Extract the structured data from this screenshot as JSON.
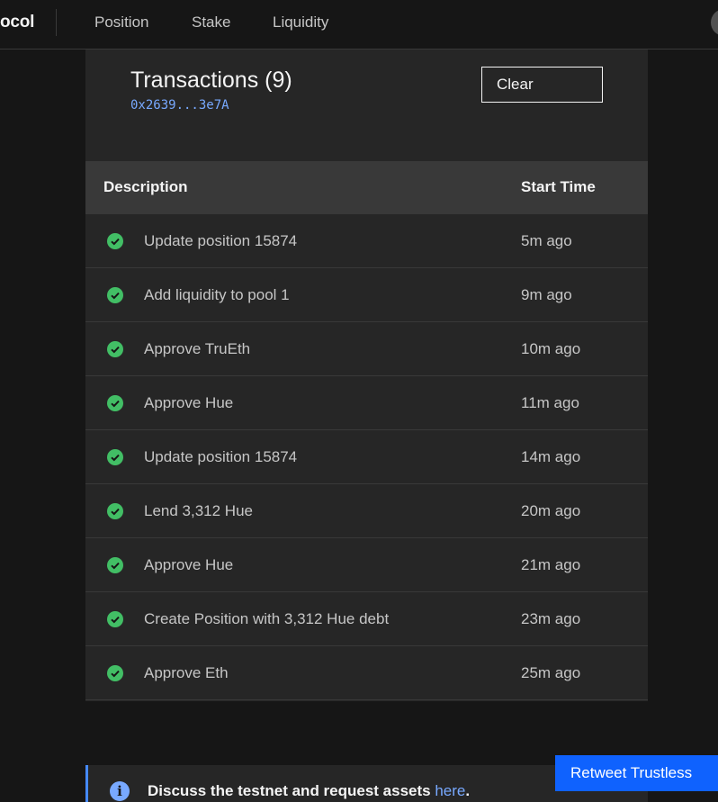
{
  "nav": {
    "brand": "ocol",
    "items": [
      "Position",
      "Stake",
      "Liquidity"
    ]
  },
  "panel": {
    "title": "Transactions (9)",
    "address": "0x2639...3e7A",
    "clear_label": "Clear"
  },
  "table": {
    "columns": [
      "Description",
      "Start Time"
    ],
    "rows": [
      {
        "status": "success",
        "description": "Update position 15874",
        "time": "5m ago"
      },
      {
        "status": "success",
        "description": "Add liquidity to pool 1",
        "time": "9m ago"
      },
      {
        "status": "success",
        "description": "Approve TruEth",
        "time": "10m ago"
      },
      {
        "status": "success",
        "description": "Approve Hue",
        "time": "11m ago"
      },
      {
        "status": "success",
        "description": "Update position 15874",
        "time": "14m ago"
      },
      {
        "status": "success",
        "description": "Lend 3,312 Hue",
        "time": "20m ago"
      },
      {
        "status": "success",
        "description": "Approve Hue",
        "time": "21m ago"
      },
      {
        "status": "success",
        "description": "Create Position with 3,312 Hue debt",
        "time": "23m ago"
      },
      {
        "status": "success",
        "description": "Approve Eth",
        "time": "25m ago"
      }
    ]
  },
  "notice": {
    "icon": "info-icon",
    "text": "Discuss the testnet and request assets ",
    "link_text": "here",
    "suffix": "."
  },
  "retweet_label": "Retweet Trustless",
  "colors": {
    "background": "#161616",
    "panel": "#262626",
    "header_row": "#393939",
    "success": "#42be65",
    "link": "#78a9ff",
    "primary_button": "#0f62fe"
  }
}
